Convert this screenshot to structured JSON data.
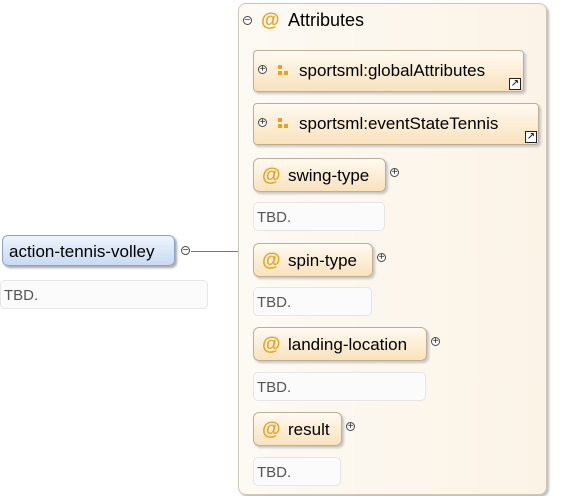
{
  "root": {
    "name": "action-tennis-volley",
    "doc": "TBD."
  },
  "group": {
    "title": "Attributes"
  },
  "refs": [
    {
      "name": "sportsml:globalAttributes"
    },
    {
      "name": "sportsml:eventStateTennis"
    }
  ],
  "attributes": [
    {
      "name": "swing-type",
      "doc": "TBD."
    },
    {
      "name": "spin-type",
      "doc": "TBD."
    },
    {
      "name": "landing-location",
      "doc": "TBD."
    },
    {
      "name": "result",
      "doc": "TBD."
    }
  ],
  "symbols": {
    "attribute": "@",
    "expand": "+",
    "collapse": "−",
    "link": "↗"
  },
  "colors": {
    "element_fill": "#c9daf3",
    "attribute_fill": "#f9e2bc",
    "attribute_symbol": "#e8a21c"
  }
}
